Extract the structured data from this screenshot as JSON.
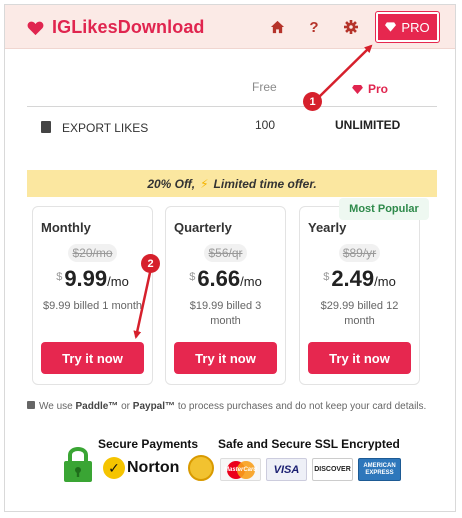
{
  "header": {
    "title": "IGLikesDownload",
    "pro_label": "PRO",
    "help_label": "?",
    "brand_color": "#e0254f",
    "header_bg": "#fbeae6",
    "icons": [
      "heart-icon",
      "home-icon",
      "help-icon",
      "gear-icon",
      "diamond-icon"
    ]
  },
  "comparison": {
    "col_free": "Free",
    "col_pro": "Pro",
    "row_label": "EXPORT LIKES",
    "row_free": "100",
    "row_pro": "UNLIMITED"
  },
  "promo": {
    "text_before": "20% Off,",
    "text_after": "Limited time offer.",
    "bg": "#fbe7a0"
  },
  "plans": [
    {
      "name": "Monthly",
      "old_price": "$20/mo",
      "currency": "$",
      "amount": "9.99",
      "per": "/mo",
      "billed": "$9.99 billed 1 month",
      "cta": "Try it now"
    },
    {
      "name": "Quarterly",
      "old_price": "$56/qr",
      "currency": "$",
      "amount": "6.66",
      "per": "/mo",
      "billed": "$19.99 billed 3 month",
      "cta": "Try it now"
    },
    {
      "name": "Yearly",
      "old_price": "$89/yr",
      "currency": "$",
      "amount": "2.49",
      "per": "/mo",
      "billed": "$29.99 billed 12 month",
      "cta": "Try it now",
      "badge": "Most Popular"
    }
  ],
  "footer": {
    "note_pre": "We use",
    "paddle": "Paddle™",
    "or": "or",
    "paypal": "Paypal™",
    "note_post": "to process purchases and do not keep your card details.",
    "secure_payments": "Secure Payments",
    "ssl": "Safe and Secure SSL Encrypted",
    "norton": "Norton",
    "mastercard": "MasterCard",
    "visa": "VISA",
    "discover": "DISCOVER",
    "amex": "AMERICAN EXPRESS"
  },
  "annotations": {
    "step1": "1",
    "step2": "2",
    "color": "#d6202c"
  }
}
